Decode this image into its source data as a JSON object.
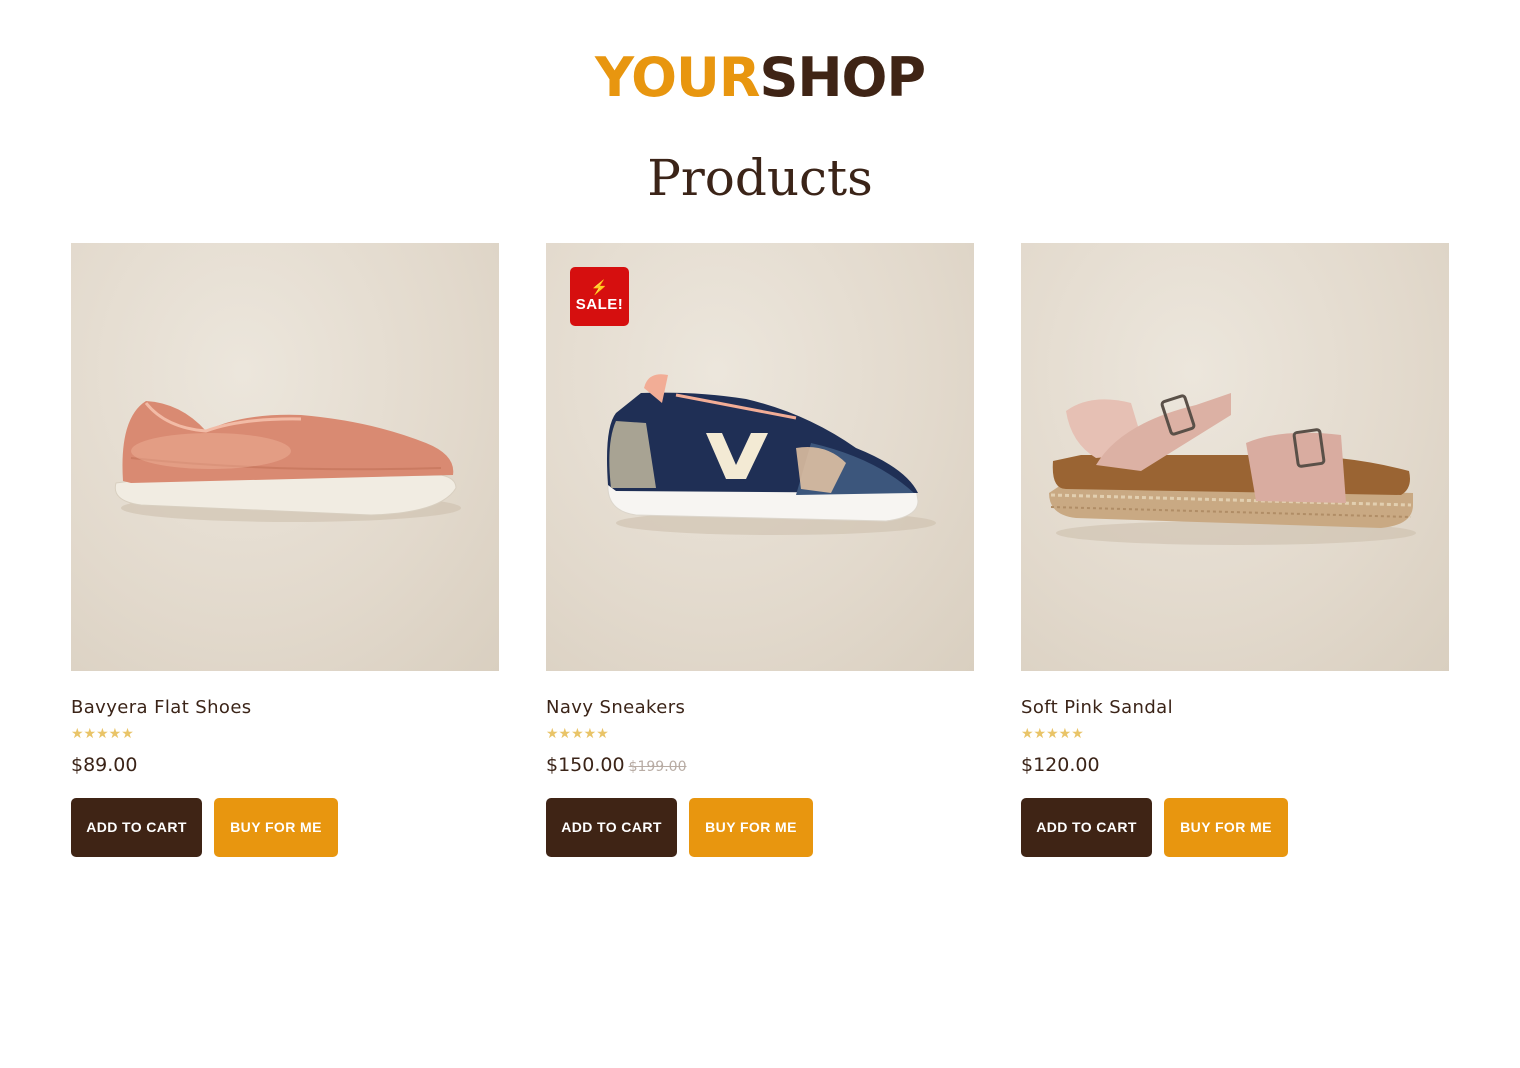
{
  "header": {
    "logo_part1": "YOUR",
    "logo_part2": "SHOP",
    "page_title": "Products"
  },
  "colors": {
    "brand_orange": "#e8960f",
    "brand_brown": "#3f2415",
    "sale_red": "#d60f0f",
    "star_gold": "#e9c468"
  },
  "products": [
    {
      "name": "Bavyera Flat Shoes",
      "rating_stars": "★★★★★",
      "rating": 5,
      "price": "$89.00",
      "old_price": "",
      "image_icon": "flat-shoe-image",
      "add_to_cart_label": "ADD TO CART",
      "buy_label": "BUY FOR ME"
    },
    {
      "name": "Navy Sneakers",
      "rating_stars": "★★★★★",
      "rating": 5,
      "price": "$150.00",
      "old_price": "$199.00",
      "badge": "SALE!",
      "image_icon": "sneaker-image",
      "add_to_cart_label": "ADD TO CART",
      "buy_label": "BUY FOR ME"
    },
    {
      "name": "Soft Pink Sandal",
      "rating_stars": "★★★★★",
      "rating": 5,
      "price": "$120.00",
      "old_price": "",
      "image_icon": "sandal-image",
      "add_to_cart_label": "ADD TO CART",
      "buy_label": "BUY FOR ME"
    }
  ]
}
